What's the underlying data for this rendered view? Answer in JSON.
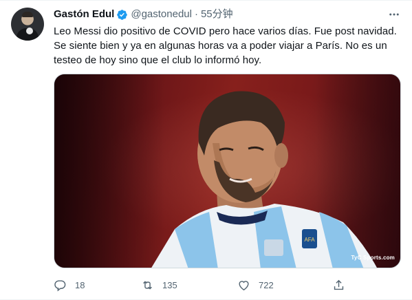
{
  "author": {
    "display_name": "Gastón Edul",
    "handle": "@gastonedul",
    "separator": "·",
    "time": "55分钟",
    "verified_icon": "verified-badge-icon"
  },
  "tweet": {
    "text": "Leo Messi dio positivo de COVID pero hace varios días. Fue post navidad. Se siente bien y ya en algunas horas va a poder viajar a París. No es un testeo de hoy sino que el club lo informó hoy."
  },
  "media": {
    "watermark": "TyC Sports.com"
  },
  "actions": {
    "reply_count": "18",
    "retweet_count": "135",
    "like_count": "722"
  },
  "colors": {
    "accent": "#1d9bf0",
    "secondary_text": "#536471",
    "primary_text": "#0f1419"
  }
}
